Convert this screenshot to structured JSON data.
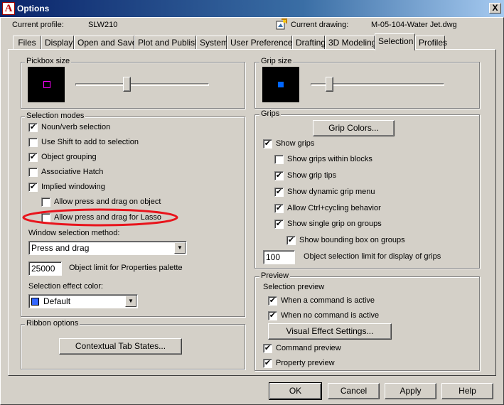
{
  "window": {
    "title": "Options",
    "close_label": "X",
    "app_icon_letter": "A"
  },
  "header": {
    "profile_label": "Current profile:",
    "profile_value": "SLW210",
    "drawing_label": "Current drawing:",
    "drawing_value": "M-05-104-Water Jet.dwg"
  },
  "tabs": [
    {
      "label": "Files"
    },
    {
      "label": "Display"
    },
    {
      "label": "Open and Save"
    },
    {
      "label": "Plot and Publish"
    },
    {
      "label": "System"
    },
    {
      "label": "User Preferences"
    },
    {
      "label": "Drafting"
    },
    {
      "label": "3D Modeling"
    },
    {
      "label": "Selection",
      "active": true
    },
    {
      "label": "Profiles"
    }
  ],
  "pickbox": {
    "title": "Pickbox size",
    "preview_color": "#ff00ff",
    "level": 0.38
  },
  "selection_modes": {
    "title": "Selection modes",
    "items": [
      {
        "label": "Noun/verb selection",
        "checked": true
      },
      {
        "label": "Use Shift to add to selection",
        "checked": false
      },
      {
        "label": "Object grouping",
        "checked": true
      },
      {
        "label": "Associative Hatch",
        "checked": false
      },
      {
        "label": "Implied windowing",
        "checked": true
      },
      {
        "label": "Allow press and drag on object",
        "checked": false
      },
      {
        "label": "Allow press and drag for Lasso",
        "checked": false
      }
    ],
    "window_method_label": "Window selection method:",
    "window_method_value": "Press and drag",
    "object_limit_value": "25000",
    "object_limit_label": "Object limit for Properties palette",
    "effect_color_label": "Selection effect color:",
    "effect_color_value": "Default",
    "effect_color_swatch": "#3366ff"
  },
  "ribbon": {
    "title": "Ribbon options",
    "button_label": "Contextual Tab States..."
  },
  "grip_size": {
    "title": "Grip size",
    "preview_color": "#0066ff",
    "level": 0.12
  },
  "grips": {
    "title": "Grips",
    "colors_button": "Grip Colors...",
    "items": [
      {
        "label": "Show grips",
        "checked": true
      },
      {
        "label": "Show grips within blocks",
        "checked": false
      },
      {
        "label": "Show grip tips",
        "checked": true
      },
      {
        "label": "Show dynamic grip menu",
        "checked": true
      },
      {
        "label": "Allow Ctrl+cycling behavior",
        "checked": true
      },
      {
        "label": "Show single grip on groups",
        "checked": true
      },
      {
        "label": "Show bounding box on groups",
        "checked": true
      }
    ],
    "limit_value": "100",
    "limit_label": "Object selection limit for display of grips"
  },
  "preview": {
    "title": "Preview",
    "selection_preview_label": "Selection preview",
    "items": [
      {
        "label": "When a command is active",
        "checked": true
      },
      {
        "label": "When no command is active",
        "checked": true
      }
    ],
    "visual_effect_button": "Visual Effect Settings...",
    "items2": [
      {
        "label": "Command preview",
        "checked": true
      },
      {
        "label": "Property preview",
        "checked": true
      }
    ]
  },
  "buttons": {
    "ok": "OK",
    "cancel": "Cancel",
    "apply": "Apply",
    "help": "Help"
  },
  "annotation": {
    "highlight_color": "#e8141c"
  },
  "check_mark": "✔",
  "dropdown_arrow": "▼"
}
